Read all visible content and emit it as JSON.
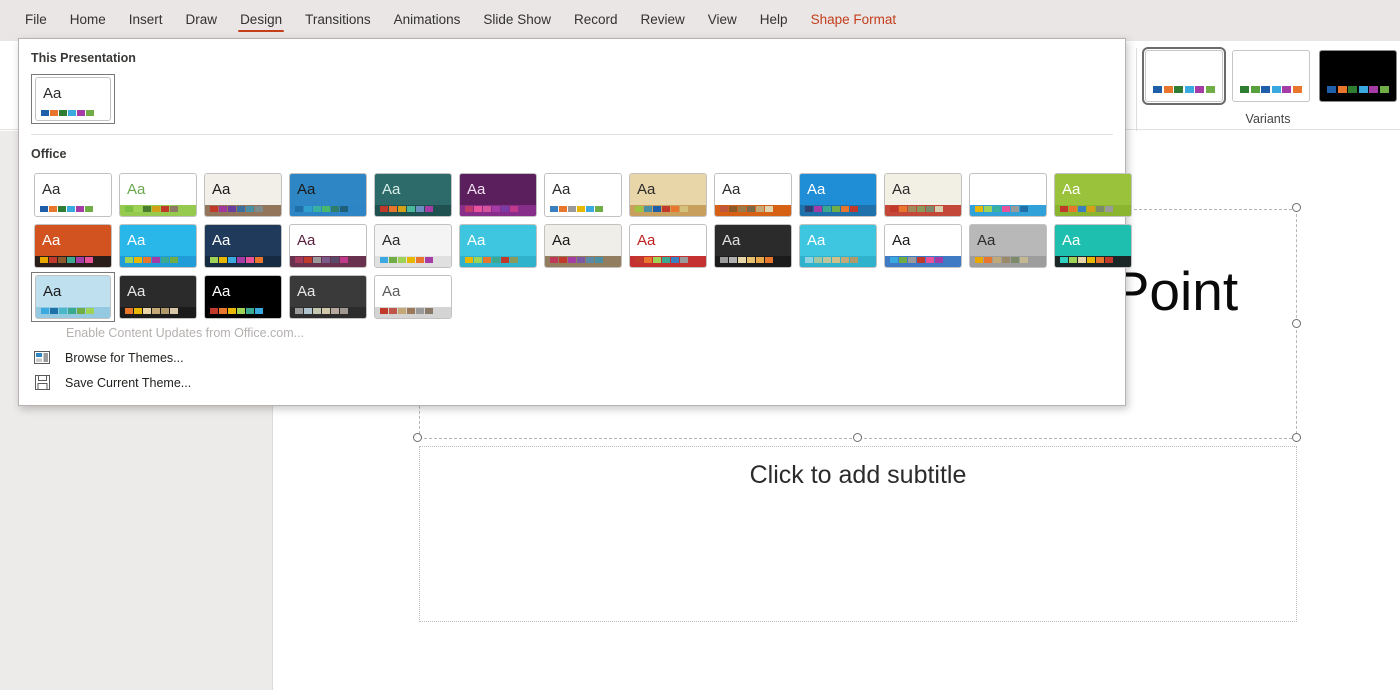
{
  "ribbon": {
    "tabs": [
      {
        "label": "File",
        "state": "normal"
      },
      {
        "label": "Home",
        "state": "normal"
      },
      {
        "label": "Insert",
        "state": "normal"
      },
      {
        "label": "Draw",
        "state": "normal"
      },
      {
        "label": "Design",
        "state": "active"
      },
      {
        "label": "Transitions",
        "state": "normal"
      },
      {
        "label": "Animations",
        "state": "normal"
      },
      {
        "label": "Slide Show",
        "state": "normal"
      },
      {
        "label": "Record",
        "state": "normal"
      },
      {
        "label": "Review",
        "state": "normal"
      },
      {
        "label": "View",
        "state": "normal"
      },
      {
        "label": "Help",
        "state": "normal"
      },
      {
        "label": "Shape Format",
        "state": "contextual"
      }
    ],
    "active_tab_underline_color": "#c43e1c",
    "contextual_tab_color": "#c43e1c"
  },
  "variants": {
    "label": "Variants",
    "items": [
      {
        "name": "variant-1",
        "selected": true,
        "background": "#ffffff",
        "swatches": [
          "#1f5fa9",
          "#e8762c",
          "#2f7d32",
          "#3aa9e0",
          "#a53ba5",
          "#70ad47"
        ]
      },
      {
        "name": "variant-2",
        "selected": false,
        "background": "#ffffff",
        "swatches": [
          "#2f7d32",
          "#57a03c",
          "#1f5fa9",
          "#3aa9e0",
          "#a53ba5",
          "#e8762c"
        ]
      },
      {
        "name": "variant-3",
        "selected": false,
        "background": "#000000",
        "swatches": [
          "#1f5fa9",
          "#e8762c",
          "#2f7d32",
          "#3aa9e0",
          "#a53ba5",
          "#70ad47"
        ]
      }
    ]
  },
  "themes_panel": {
    "this_presentation_label": "This Presentation",
    "office_label": "Office",
    "this_presentation": [
      {
        "name": "office-theme-current",
        "selected": true,
        "bg": "#ffffff",
        "aa_color": "#2b2b2b",
        "swatches": [
          "#1f5fa9",
          "#e8762c",
          "#2f7d32",
          "#3aa9e0",
          "#a53ba5",
          "#70ad47"
        ]
      }
    ],
    "office_themes_row1": [
      {
        "name": "office",
        "bg": "#ffffff",
        "aa_color": "#2b2b2b",
        "swatches": [
          "#1f5fa9",
          "#e8762c",
          "#2f7d32",
          "#3aa9e0",
          "#a53ba5",
          "#70ad47"
        ]
      },
      {
        "name": "facet",
        "bg": "#ffffff",
        "aa_color": "#6aa84f",
        "accent": "#8cc63f",
        "swatches": [
          "#7bc043",
          "#9fd356",
          "#4a7c2f",
          "#d4a017",
          "#c0392b",
          "#8d7966"
        ]
      },
      {
        "name": "ion-boardroom",
        "bg": "#f2efe9",
        "aa_color": "#1a1a1a",
        "accent": "#8b6a4f",
        "swatches": [
          "#c0392b",
          "#a0399b",
          "#6a3fa0",
          "#3a6fa0",
          "#4a90a4",
          "#7f8c8d"
        ]
      },
      {
        "name": "droplet",
        "bg": "#2f86c4",
        "aa_color": "#1a1a1a",
        "accent": "#2f86c4",
        "swatches": [
          "#1f6fa8",
          "#2f9fd0",
          "#3ab0a0",
          "#4ab86a",
          "#2f7d6a",
          "#1f5f7a"
        ]
      },
      {
        "name": "slice",
        "bg": "#2d6b6b",
        "aa_color": "#d8eee8",
        "accent": "#1f4f4f",
        "swatches": [
          "#c0392b",
          "#e8762c",
          "#d4a017",
          "#4ab89a",
          "#6a8fc0",
          "#a53ba5"
        ]
      },
      {
        "name": "vapor-trail",
        "bg": "#5b1f5e",
        "aa_color": "#f0e0f0",
        "accent": "#8b2f8e",
        "swatches": [
          "#c0396b",
          "#e8529b",
          "#d4549b",
          "#a53ba5",
          "#7a3ba5",
          "#c0398b"
        ]
      },
      {
        "name": "view",
        "bg": "#ffffff",
        "aa_color": "#2b2b2b",
        "swatches": [
          "#3a7fc0",
          "#e8762c",
          "#9a9a9a",
          "#e8b800",
          "#3aa9e0",
          "#70ad47"
        ]
      },
      {
        "name": "wisp",
        "bg": "#e8d5a8",
        "aa_color": "#2b2b2b",
        "accent": "#c49a56",
        "swatches": [
          "#9fc43f",
          "#4a90a4",
          "#1f5fa9",
          "#c0392b",
          "#e8762c",
          "#d4c07a"
        ]
      },
      {
        "name": "berlin",
        "bg": "#ffffff",
        "aa_color": "#2b2b2b",
        "accent": "#d35400",
        "swatches": [
          "#c0563b",
          "#8b5a2b",
          "#9a7a4a",
          "#7a6a4a",
          "#c4a878",
          "#e0d5b0"
        ]
      },
      {
        "name": "celestial",
        "bg": "#1f8ed6",
        "aa_color": "#ffffff",
        "accent": "#1f6fa8",
        "swatches": [
          "#2f3f6f",
          "#a53ba5",
          "#3aa990",
          "#70ad47",
          "#e8762c",
          "#c0392b"
        ]
      },
      {
        "name": "crop",
        "bg": "#f2f0e4",
        "aa_color": "#2b2b2b",
        "accent": "#c0392b",
        "swatches": [
          "#c0392b",
          "#e8762c",
          "#a08a5a",
          "#8a9a5a",
          "#7a8a6a",
          "#d8d0b0"
        ]
      },
      {
        "name": "depth",
        "bg": "#ffffff",
        "aa_color": "#ffffff",
        "accent": "#1f9ad6",
        "swatches": [
          "#e8b800",
          "#9fd356",
          "#3ab0a0",
          "#e8529b",
          "#9a9a9a",
          "#1f6fa8"
        ]
      },
      {
        "name": "dividend",
        "bg": "#9ac23a",
        "aa_color": "#ffffff",
        "accent": "#8ab32f",
        "swatches": [
          "#c0392b",
          "#e8762c",
          "#3a7fc0",
          "#d4a017",
          "#7a8a6a",
          "#9a9a9a"
        ]
      }
    ],
    "office_themes_row2": [
      {
        "name": "frame",
        "bg": "#d2531f",
        "aa_color": "#ffffff",
        "accent": "#1a1a1a",
        "swatches": [
          "#e8a800",
          "#c0392b",
          "#8a5a2b",
          "#3aa990",
          "#a53ba5",
          "#e8529b"
        ]
      },
      {
        "name": "mesh",
        "bg": "#29b6e8",
        "aa_color": "#ffffff",
        "accent": "#1f9ad6",
        "swatches": [
          "#9fd356",
          "#e8b800",
          "#e8762c",
          "#a53ba5",
          "#3aa990",
          "#70ad47"
        ]
      },
      {
        "name": "metropolitan",
        "bg": "#1f3a5a",
        "aa_color": "#ffffff",
        "accent": "#16293f",
        "swatches": [
          "#9fd356",
          "#e8b800",
          "#3aa9e0",
          "#a53ba5",
          "#e8529b",
          "#e8762c"
        ]
      },
      {
        "name": "parallax",
        "bg": "#ffffff",
        "aa_color": "#5b1f3e",
        "accent": "#5b1f3e",
        "swatches": [
          "#a5395b",
          "#c0392b",
          "#9a9a9a",
          "#7a5a8a",
          "#5a4a6a",
          "#c0398b"
        ]
      },
      {
        "name": "quotable",
        "bg": "#f4f4f4",
        "aa_color": "#2b2b2b",
        "accent": "#dddddd",
        "swatches": [
          "#3aa9e0",
          "#70ad47",
          "#9fd356",
          "#e8b800",
          "#e8762c",
          "#a53ba5"
        ]
      },
      {
        "name": "savon",
        "bg": "#3ec6e0",
        "aa_color": "#ffffff",
        "accent": "#2fb0ca",
        "swatches": [
          "#e8b800",
          "#9fd356",
          "#e8762c",
          "#3aa990",
          "#c0392b",
          "#8a9a5a"
        ]
      },
      {
        "name": "banded",
        "bg": "#f0eee9",
        "aa_color": "#1a1a1a",
        "accent": "#8b7355",
        "swatches": [
          "#c0395b",
          "#c0392b",
          "#a53ba5",
          "#7a5aa5",
          "#5a8aa5",
          "#4a90a4"
        ]
      },
      {
        "name": "basis",
        "bg": "#ffffff",
        "aa_color": "#c0201f",
        "accent": "#c0201f",
        "swatches": [
          "#c0392b",
          "#e8762c",
          "#9fd356",
          "#3aa990",
          "#3a7fc0",
          "#9a9a9a"
        ]
      },
      {
        "name": "badge",
        "bg": "#2b2b2b",
        "aa_color": "#e0e0e0",
        "accent": "#1a1a1a",
        "swatches": [
          "#9a9a9a",
          "#b0b0b0",
          "#e8d5a8",
          "#e8c070",
          "#e8a84a",
          "#e8762c"
        ]
      },
      {
        "name": "berlin-alt",
        "bg": "#3ec6e0",
        "aa_color": "#ffffff",
        "accent": "#2fb0ca",
        "swatches": [
          "#8fd3e0",
          "#a5c4a0",
          "#c0c49a",
          "#d0c08a",
          "#c4a878",
          "#b09a6a"
        ]
      },
      {
        "name": "circuit",
        "bg": "#ffffff",
        "aa_color": "#1a1a1a",
        "accent": "#2f6fc0",
        "swatches": [
          "#3aa9e0",
          "#70ad47",
          "#9a9a9a",
          "#c0392b",
          "#e8529b",
          "#a53ba5"
        ]
      },
      {
        "name": "damask",
        "bg": "#b8b8b8",
        "aa_color": "#2b2b2b",
        "accent": "#9a9a9a",
        "swatches": [
          "#e8a800",
          "#e8762c",
          "#c0a878",
          "#9a8a6a",
          "#7a8a6a",
          "#c4b890"
        ]
      },
      {
        "name": "droplet-teal",
        "bg": "#1fbfb0",
        "aa_color": "#ffffff",
        "accent": "#1a1a1a",
        "swatches": [
          "#2fd0c0",
          "#9fd356",
          "#e8d5a8",
          "#e8b800",
          "#e8762c",
          "#c0392b"
        ]
      }
    ],
    "office_themes_row3": [
      {
        "name": "feathered",
        "bg": "#bfe0ef",
        "aa_color": "#1a1a1a",
        "accent": "#8fc8e0",
        "selected": true,
        "swatches": [
          "#3aa9e0",
          "#1f6fa8",
          "#4ab8c8",
          "#3aa990",
          "#70ad47",
          "#9fd356"
        ]
      },
      {
        "name": "gallery",
        "bg": "#2b2b2b",
        "aa_color": "#e8e8e8",
        "accent": "#1a1a1a",
        "swatches": [
          "#e8762c",
          "#e8b800",
          "#e8d5a8",
          "#c4a878",
          "#b09a6a",
          "#d8c8a8"
        ]
      },
      {
        "name": "ion",
        "bg": "#000000",
        "aa_color": "#ffffff",
        "accent": "#000000",
        "swatches": [
          "#c0392b",
          "#e8762c",
          "#e8b800",
          "#9fd356",
          "#3aa990",
          "#3aa9e0"
        ]
      },
      {
        "name": "main-event",
        "bg": "#3a3a3a",
        "aa_color": "#e8e8e8",
        "accent": "#2b2b2b",
        "swatches": [
          "#9a9a9a",
          "#b0c4d0",
          "#c4c8b0",
          "#d0c8a8",
          "#b8a8a0",
          "#a09890"
        ]
      },
      {
        "name": "organic",
        "bg": "#ffffff",
        "aa_color": "#5a5a5a",
        "accent": "#d0d0d0",
        "swatches": [
          "#c0392b",
          "#c0564a",
          "#c4a878",
          "#9a7a5a",
          "#9a9a9a",
          "#8a7a6a"
        ]
      }
    ],
    "commands": [
      {
        "name": "enable-content-updates",
        "label": "Enable Content Updates from Office.com...",
        "disabled": true,
        "icon": "none"
      },
      {
        "name": "browse-for-themes",
        "label": "Browse for Themes...",
        "disabled": false,
        "icon": "folder-browse-icon"
      },
      {
        "name": "save-current-theme",
        "label": "Save Current Theme...",
        "disabled": false,
        "icon": "save-disk-icon"
      }
    ]
  },
  "slide": {
    "title": "Would you like to a PowerPoint Presentation?",
    "subtitle_placeholder": "Click to add subtitle"
  }
}
